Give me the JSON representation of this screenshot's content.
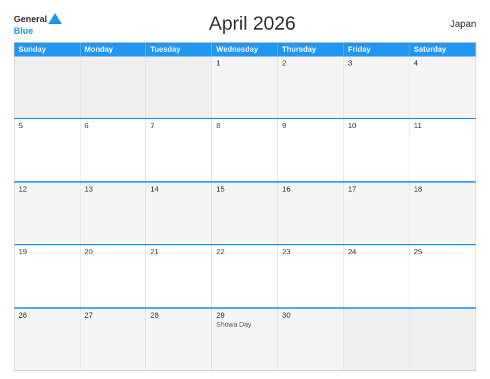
{
  "header": {
    "title": "April 2026",
    "country": "Japan",
    "logo_general": "General",
    "logo_blue": "Blue"
  },
  "weekdays": [
    "Sunday",
    "Monday",
    "Tuesday",
    "Wednesday",
    "Thursday",
    "Friday",
    "Saturday"
  ],
  "weeks": [
    [
      {
        "day": "",
        "empty": true
      },
      {
        "day": "",
        "empty": true
      },
      {
        "day": "",
        "empty": true
      },
      {
        "day": "1",
        "empty": false
      },
      {
        "day": "2",
        "empty": false
      },
      {
        "day": "3",
        "empty": false
      },
      {
        "day": "4",
        "empty": false
      }
    ],
    [
      {
        "day": "5",
        "empty": false
      },
      {
        "day": "6",
        "empty": false
      },
      {
        "day": "7",
        "empty": false
      },
      {
        "day": "8",
        "empty": false
      },
      {
        "day": "9",
        "empty": false
      },
      {
        "day": "10",
        "empty": false
      },
      {
        "day": "11",
        "empty": false
      }
    ],
    [
      {
        "day": "12",
        "empty": false
      },
      {
        "day": "13",
        "empty": false
      },
      {
        "day": "14",
        "empty": false
      },
      {
        "day": "15",
        "empty": false
      },
      {
        "day": "16",
        "empty": false
      },
      {
        "day": "17",
        "empty": false
      },
      {
        "day": "18",
        "empty": false
      }
    ],
    [
      {
        "day": "19",
        "empty": false
      },
      {
        "day": "20",
        "empty": false
      },
      {
        "day": "21",
        "empty": false
      },
      {
        "day": "22",
        "empty": false
      },
      {
        "day": "23",
        "empty": false
      },
      {
        "day": "24",
        "empty": false
      },
      {
        "day": "25",
        "empty": false
      }
    ],
    [
      {
        "day": "26",
        "empty": false
      },
      {
        "day": "27",
        "empty": false
      },
      {
        "day": "28",
        "empty": false
      },
      {
        "day": "29",
        "empty": false,
        "event": "Showa Day"
      },
      {
        "day": "30",
        "empty": false
      },
      {
        "day": "",
        "empty": true
      },
      {
        "day": "",
        "empty": true
      }
    ]
  ],
  "colors": {
    "header_bg": "#2196F3",
    "accent": "#2196F3"
  }
}
